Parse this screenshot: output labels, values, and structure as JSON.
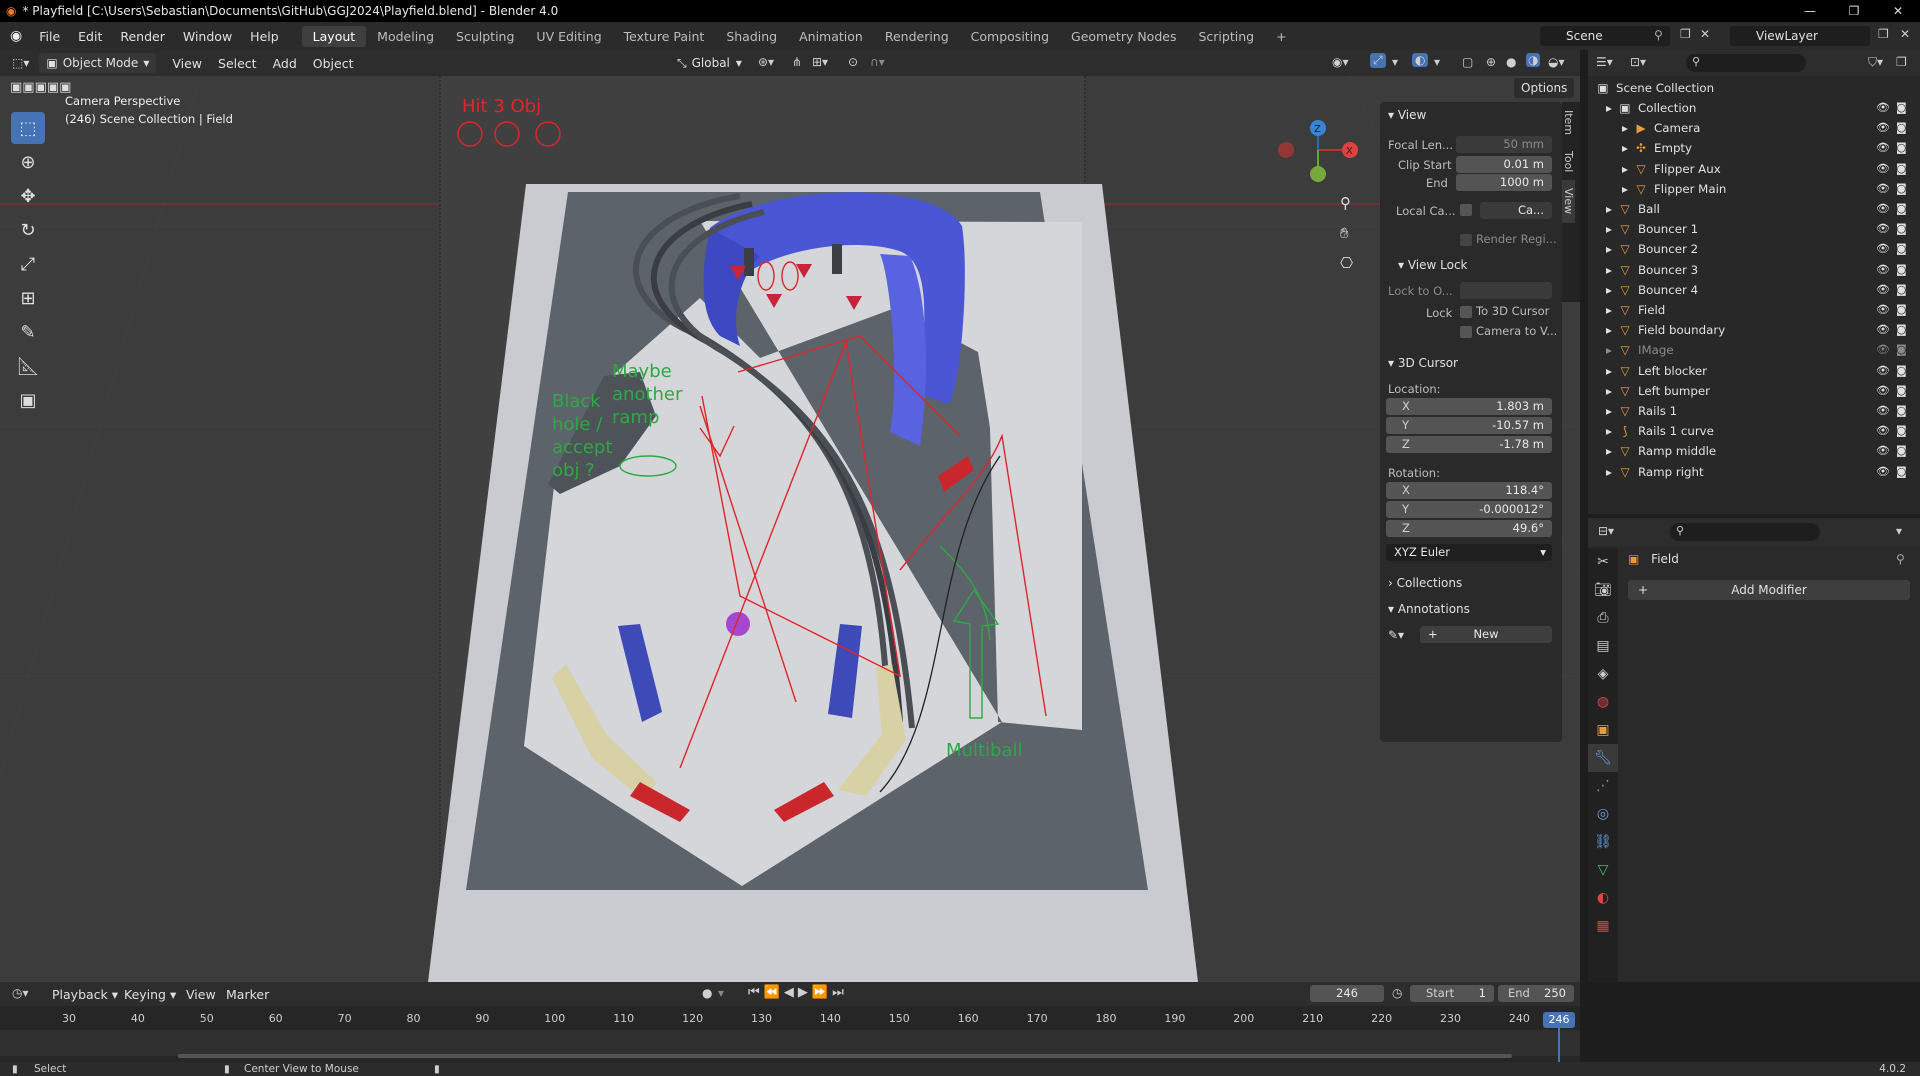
{
  "window": {
    "title": "* Playfield [C:\\Users\\Sebastian\\Documents\\GitHub\\GGJ2024\\Playfield.blend] - Blender 4.0"
  },
  "menu": [
    "File",
    "Edit",
    "Render",
    "Window",
    "Help"
  ],
  "workspaces": [
    "Layout",
    "Modeling",
    "Sculpting",
    "UV Editing",
    "Texture Paint",
    "Shading",
    "Animation",
    "Rendering",
    "Compositing",
    "Geometry Nodes",
    "Scripting"
  ],
  "scene": {
    "name": "Scene",
    "view_layer": "ViewLayer"
  },
  "header": {
    "mode": "Object Mode",
    "view": "View",
    "select": "Select",
    "add": "Add",
    "object": "Object",
    "transform": "Global",
    "options": "Options"
  },
  "viewport": {
    "overlay_line1": "Camera Perspective",
    "overlay_line2": "(246) Scene Collection | Field",
    "note_hit": "Hit 3 Obj",
    "note_black_1": "Black",
    "note_black_2": "hole /",
    "note_black_3": "accept",
    "note_black_4": "obj ?",
    "note_ramp_1": "Maybe",
    "note_ramp_2": "another",
    "note_ramp_3": "ramp",
    "note_multiball": "Multiball"
  },
  "npanel": {
    "tabs": [
      "Item",
      "Tool",
      "View"
    ],
    "view_title": "View",
    "focal_label": "Focal Len...",
    "focal_value": "50 mm",
    "clip_start_label": "Clip Start",
    "clip_start_value": "0.01 m",
    "clip_end_label": "End",
    "clip_end_value": "1000 m",
    "local_cam_label": "Local Ca...",
    "local_cam_value": "Ca...",
    "render_region": "Render Regi...",
    "view_lock_title": "View Lock",
    "lock_to_label": "Lock to O...",
    "lock_label": "Lock",
    "lock_cursor": "To 3D Cursor",
    "camera_to_view": "Camera to V...",
    "cursor_title": "3D Cursor",
    "location_label": "Location:",
    "loc_x": "1.803 m",
    "loc_y": "-10.57 m",
    "loc_z": "-1.78 m",
    "rotation_label": "Rotation:",
    "rot_x": "118.4°",
    "rot_y": "-0.000012°",
    "rot_z": "49.6°",
    "rot_mode": "XYZ Euler",
    "axis_x": "X",
    "axis_y": "Y",
    "axis_z": "Z",
    "collections_title": "Collections",
    "annotations_title": "Annotations",
    "new_label": "New"
  },
  "outliner": {
    "root": "Scene Collection",
    "items": [
      {
        "name": "Collection",
        "depth": 1,
        "icon": "collection-icon"
      },
      {
        "name": "Camera",
        "depth": 2,
        "icon": "camera-icon"
      },
      {
        "name": "Empty",
        "depth": 2,
        "icon": "empty-icon"
      },
      {
        "name": "Flipper Aux",
        "depth": 2,
        "icon": "mesh-icon"
      },
      {
        "name": "Flipper Main",
        "depth": 2,
        "icon": "mesh-icon"
      },
      {
        "name": "Ball",
        "depth": 1,
        "icon": "mesh-icon"
      },
      {
        "name": "Bouncer 1",
        "depth": 1,
        "icon": "mesh-icon"
      },
      {
        "name": "Bouncer 2",
        "depth": 1,
        "icon": "mesh-icon"
      },
      {
        "name": "Bouncer 3",
        "depth": 1,
        "icon": "mesh-icon"
      },
      {
        "name": "Bouncer 4",
        "depth": 1,
        "icon": "mesh-icon"
      },
      {
        "name": "Field",
        "depth": 1,
        "icon": "mesh-icon"
      },
      {
        "name": "Field boundary",
        "depth": 1,
        "icon": "mesh-icon"
      },
      {
        "name": "IMage",
        "depth": 1,
        "icon": "mesh-icon"
      },
      {
        "name": "Left blocker",
        "depth": 1,
        "icon": "mesh-icon"
      },
      {
        "name": "Left bumper",
        "depth": 1,
        "icon": "mesh-icon"
      },
      {
        "name": "Rails 1",
        "depth": 1,
        "icon": "mesh-icon"
      },
      {
        "name": "Rails 1 curve",
        "depth": 1,
        "icon": "curve-icon"
      },
      {
        "name": "Ramp middle",
        "depth": 1,
        "icon": "mesh-icon"
      },
      {
        "name": "Ramp right",
        "depth": 1,
        "icon": "mesh-icon"
      }
    ]
  },
  "properties": {
    "object": "Field",
    "add_modifier": "Add Modifier"
  },
  "timeline": {
    "playback": "Playback",
    "keying": "Keying",
    "view": "View",
    "marker": "Marker",
    "current_frame": "246",
    "start_label": "Start",
    "start": "1",
    "end_label": "End",
    "end": "250",
    "ticks": [
      "30",
      "40",
      "50",
      "60",
      "70",
      "80",
      "90",
      "100",
      "110",
      "120",
      "130",
      "140",
      "150",
      "160",
      "170",
      "180",
      "190",
      "200",
      "210",
      "220",
      "230",
      "240"
    ]
  },
  "status": {
    "left": "Select",
    "middle": "Center View to Mouse",
    "version": "4.0.2"
  },
  "colors": {
    "accent": "#4772b3",
    "annotation_red": "#e0252a",
    "annotation_green": "#2ea843",
    "ramp_blue": "#4a56d4"
  }
}
